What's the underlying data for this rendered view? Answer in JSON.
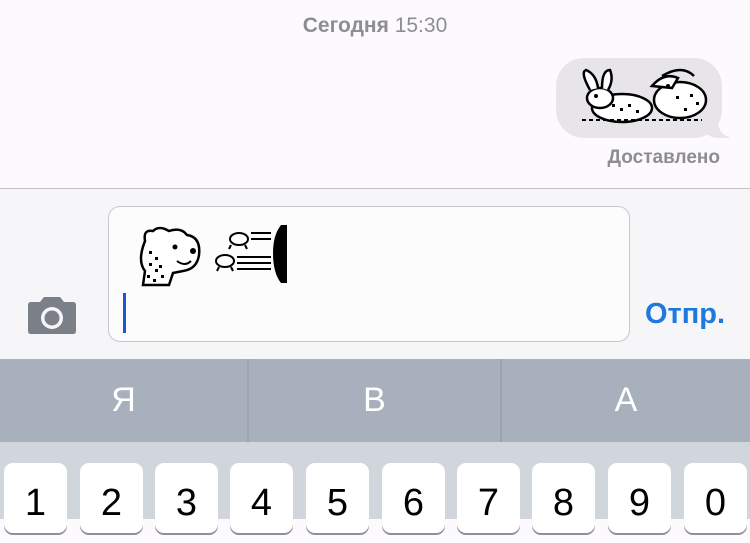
{
  "conversation": {
    "timestamp_day": "Сегодня",
    "timestamp_time": "15:30",
    "sent_message_sticker": "rabbits-sticker",
    "delivery_status": "Доставлено"
  },
  "composer": {
    "draft_stickers": [
      "bear-sticker",
      "flying-bugs-sticker"
    ],
    "camera_icon": "camera-icon",
    "send_label": "Отпр."
  },
  "suggestions": [
    "Я",
    "В",
    "А"
  ],
  "keyboard": {
    "number_row": [
      "1",
      "2",
      "3",
      "4",
      "5",
      "6",
      "7",
      "8",
      "9",
      "0"
    ]
  },
  "colors": {
    "accent": "#1e78e0",
    "bubble": "#e7e5ea",
    "suggestion_bar": "#a9b0bd",
    "keyboard_bg": "#d1d5dc"
  }
}
